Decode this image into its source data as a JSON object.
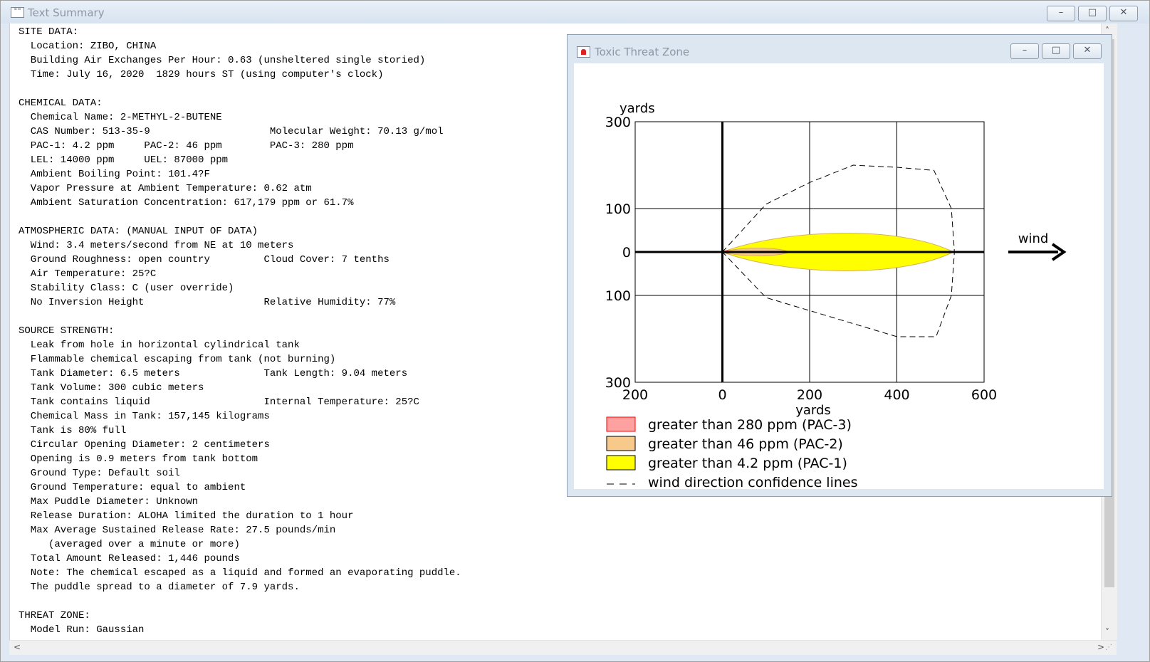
{
  "main_window": {
    "title": "Text Summary",
    "icon_text": "\"\"",
    "buttons": {
      "minimize": "–",
      "maximize": "□",
      "close": "✕"
    }
  },
  "report_lines": [
    "SITE DATA:",
    "  Location: ZIBO, CHINA",
    "  Building Air Exchanges Per Hour: 0.63 (unsheltered single storied)",
    "  Time: July 16, 2020  1829 hours ST (using computer's clock)",
    "",
    "CHEMICAL DATA:",
    "  Chemical Name: 2-METHYL-2-BUTENE",
    "  CAS Number: 513-35-9                    Molecular Weight: 70.13 g/mol",
    "  PAC-1: 4.2 ppm     PAC-2: 46 ppm        PAC-3: 280 ppm",
    "  LEL: 14000 ppm     UEL: 87000 ppm",
    "  Ambient Boiling Point: 101.4?F",
    "  Vapor Pressure at Ambient Temperature: 0.62 atm",
    "  Ambient Saturation Concentration: 617,179 ppm or 61.7%",
    "",
    "ATMOSPHERIC DATA: (MANUAL INPUT OF DATA)",
    "  Wind: 3.4 meters/second from NE at 10 meters",
    "  Ground Roughness: open country         Cloud Cover: 7 tenths",
    "  Air Temperature: 25?C",
    "  Stability Class: C (user override)",
    "  No Inversion Height                    Relative Humidity: 77%",
    "",
    "SOURCE STRENGTH:",
    "  Leak from hole in horizontal cylindrical tank",
    "  Flammable chemical escaping from tank (not burning)",
    "  Tank Diameter: 6.5 meters              Tank Length: 9.04 meters",
    "  Tank Volume: 300 cubic meters",
    "  Tank contains liquid                   Internal Temperature: 25?C",
    "  Chemical Mass in Tank: 157,145 kilograms",
    "  Tank is 80% full",
    "  Circular Opening Diameter: 2 centimeters",
    "  Opening is 0.9 meters from tank bottom",
    "  Ground Type: Default soil",
    "  Ground Temperature: equal to ambient",
    "  Max Puddle Diameter: Unknown",
    "  Release Duration: ALOHA limited the duration to 1 hour",
    "  Max Average Sustained Release Rate: 27.5 pounds/min",
    "     (averaged over a minute or more)",
    "  Total Amount Released: 1,446 pounds",
    "  Note: The chemical escaped as a liquid and formed an evaporating puddle.",
    "  The puddle spread to a diameter of 7.9 yards.",
    "",
    "THREAT ZONE:",
    "  Model Run: Gaussian"
  ],
  "scroll": {
    "up": "˄",
    "down": "˅",
    "left": "<",
    "right": ">",
    "grip": "⋰"
  },
  "threat_window": {
    "title": "Toxic Threat Zone",
    "buttons": {
      "minimize": "–",
      "maximize": "□",
      "close": "✕"
    }
  },
  "chart_data": {
    "type": "area",
    "y_unit_label": "yards",
    "xlabel": "yards",
    "x_ticks": [
      "200",
      "0",
      "200",
      "400",
      "600"
    ],
    "x_tick_values": [
      -200,
      0,
      200,
      400,
      600
    ],
    "y_ticks": [
      "300",
      "100",
      "0",
      "100",
      "300"
    ],
    "y_tick_values": [
      300,
      100,
      0,
      -100,
      -300
    ],
    "xlim": [
      -200,
      600
    ],
    "ylim": [
      -300,
      300
    ],
    "grid": true,
    "wind_label": "wind",
    "zones": [
      {
        "name": "greater than 280 ppm (PAC-3)",
        "color": "#ff4444",
        "downwind": 20,
        "halfwidth": 3
      },
      {
        "name": "greater than 46 ppm (PAC-2)",
        "color": "#f7c98a",
        "downwind": 155,
        "halfwidth": 10
      },
      {
        "name": "greater than 4.2 ppm (PAC-1)",
        "color": "#ffff00",
        "downwind": 530,
        "halfwidth": 48
      }
    ],
    "confidence_lines": {
      "name": "wind direction confidence lines",
      "points": [
        [
          0,
          0
        ],
        [
          100,
          110
        ],
        [
          200,
          160
        ],
        [
          300,
          200
        ],
        [
          400,
          195
        ],
        [
          485,
          188
        ],
        [
          525,
          100
        ],
        [
          532,
          0
        ],
        [
          525,
          -100
        ],
        [
          490,
          -195
        ],
        [
          400,
          -195
        ],
        [
          300,
          -165
        ],
        [
          200,
          -135
        ],
        [
          100,
          -105
        ],
        [
          0,
          0
        ]
      ]
    },
    "legend_placement": "bottom-left"
  }
}
